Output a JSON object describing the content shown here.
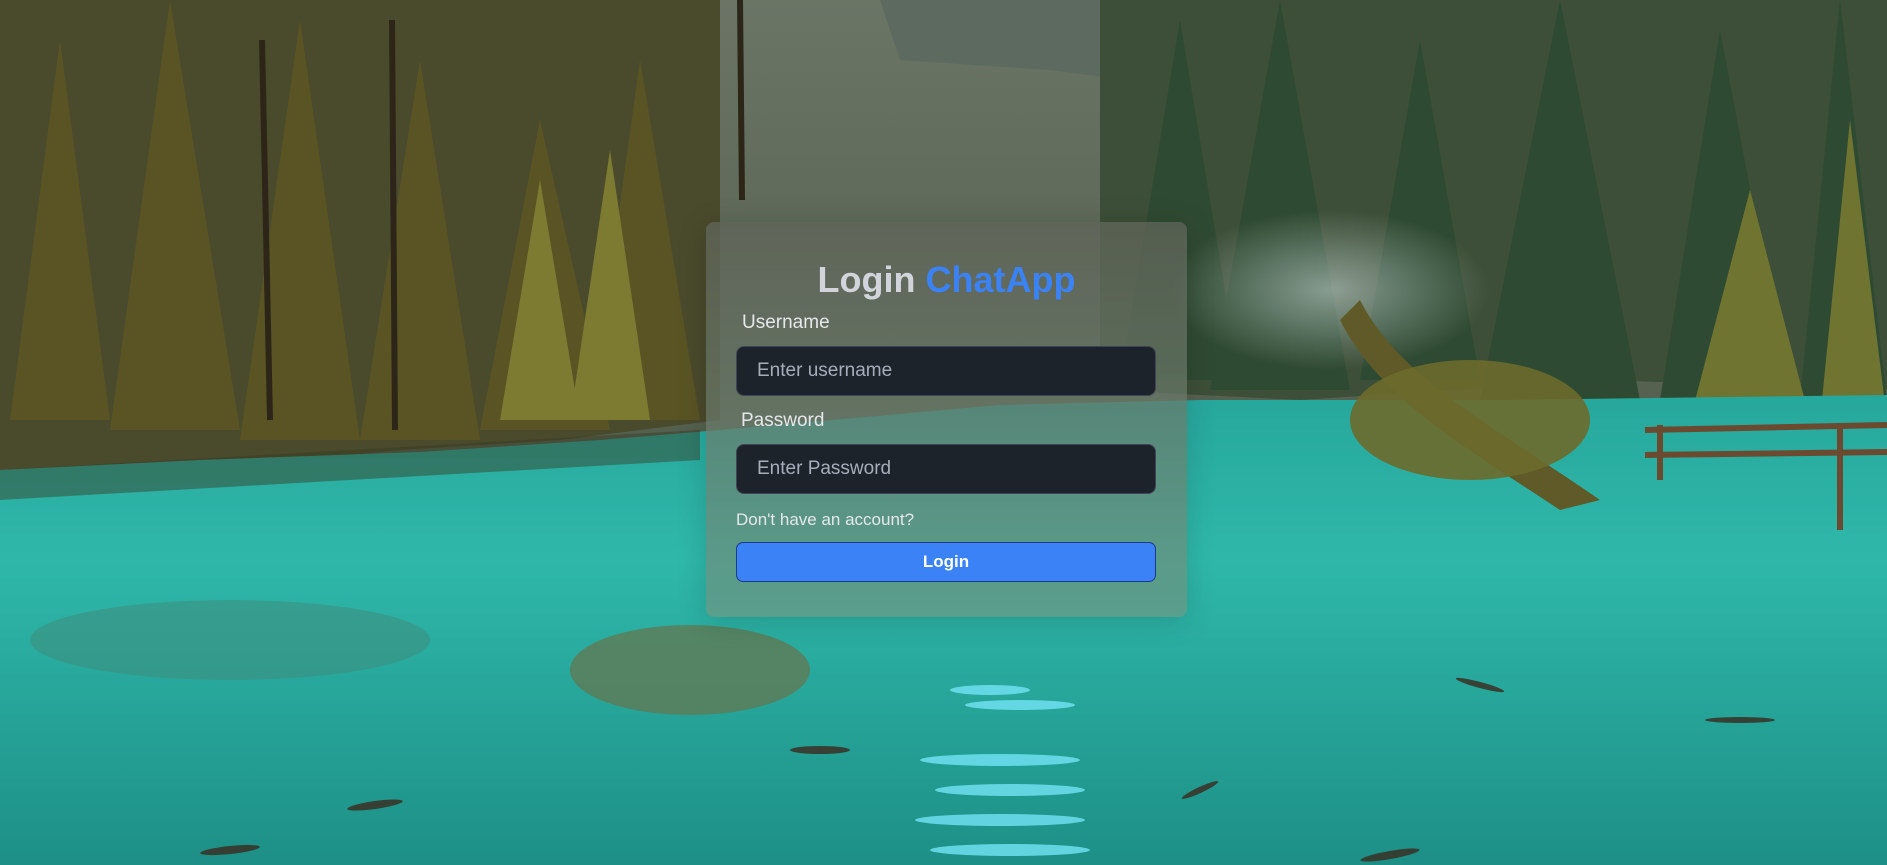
{
  "login": {
    "title_prefix": "Login",
    "title_brand": "ChatApp",
    "username_label": "Username",
    "username_placeholder": "Enter username",
    "username_value": "",
    "password_label": "Password",
    "password_placeholder": "Enter Password",
    "password_value": "",
    "signup_link": "Don't have an account?",
    "submit_label": "Login"
  },
  "colors": {
    "brand": "#3b82f6",
    "button": "#3b82f6",
    "input_background": "#1d232a",
    "lake": "#2fb5a6"
  }
}
